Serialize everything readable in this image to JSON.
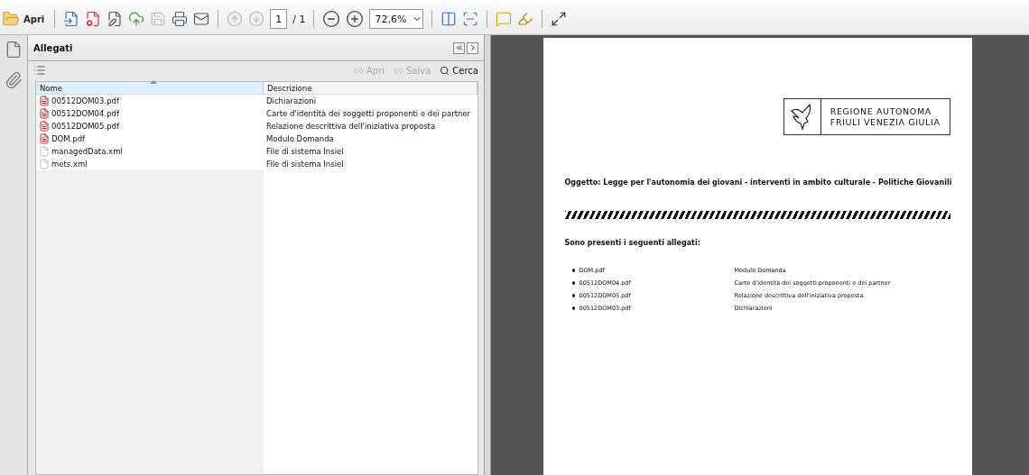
{
  "toolbar": {
    "open_label": "Apri",
    "page_number": "1",
    "page_total": "/ 1",
    "zoom": "72,6%"
  },
  "attachments": {
    "title": "Allegati",
    "actions": [
      {
        "label": "Apri",
        "disabled": true
      },
      {
        "label": "Salva",
        "disabled": true
      },
      {
        "label": "Cerca",
        "disabled": false
      }
    ],
    "columns": [
      {
        "label": "Nome",
        "sorted": true
      },
      {
        "label": "Descrizione",
        "sorted": false
      }
    ],
    "rows": [
      {
        "kind": "pdf",
        "name": "00512DOM03.pdf",
        "description": "Dichiarazioni"
      },
      {
        "kind": "pdf",
        "name": "00512DOM04.pdf",
        "description": "Carte d'identità dei soggetti proponenti e dei partner"
      },
      {
        "kind": "pdf",
        "name": "00512DOM05.pdf",
        "description": "Relazione descrittiva dell'iniziativa proposta"
      },
      {
        "kind": "pdf",
        "name": "DOM.pdf",
        "description": "Modulo Domanda"
      },
      {
        "kind": "xml",
        "name": "managedData.xml",
        "description": "File di sistema Insiel"
      },
      {
        "kind": "xml",
        "name": "mets.xml",
        "description": "File di sistema Insiel"
      }
    ]
  },
  "document": {
    "logo_lines": [
      "REGIONE AUTONOMA",
      "FRIULI VENEZIA GIULIA"
    ],
    "subject": "Oggetto: Legge per l'autonomia dei giovani - interventi in ambito culturale - Politiche Giovanili",
    "list_heading": "Sono presenti i seguenti allegati:",
    "items": [
      {
        "name": "DOM.pdf",
        "description": "Modulo Domanda"
      },
      {
        "name": "00512DOM04.pdf",
        "description": "Carte d'identità dei soggetti proponenti e dei partner"
      },
      {
        "name": "00512DOM05.pdf",
        "description": "Relazione descrittiva dell'iniziativa proposta"
      },
      {
        "name": "00512DOM03.pdf",
        "description": "Dichiarazioni"
      }
    ]
  }
}
